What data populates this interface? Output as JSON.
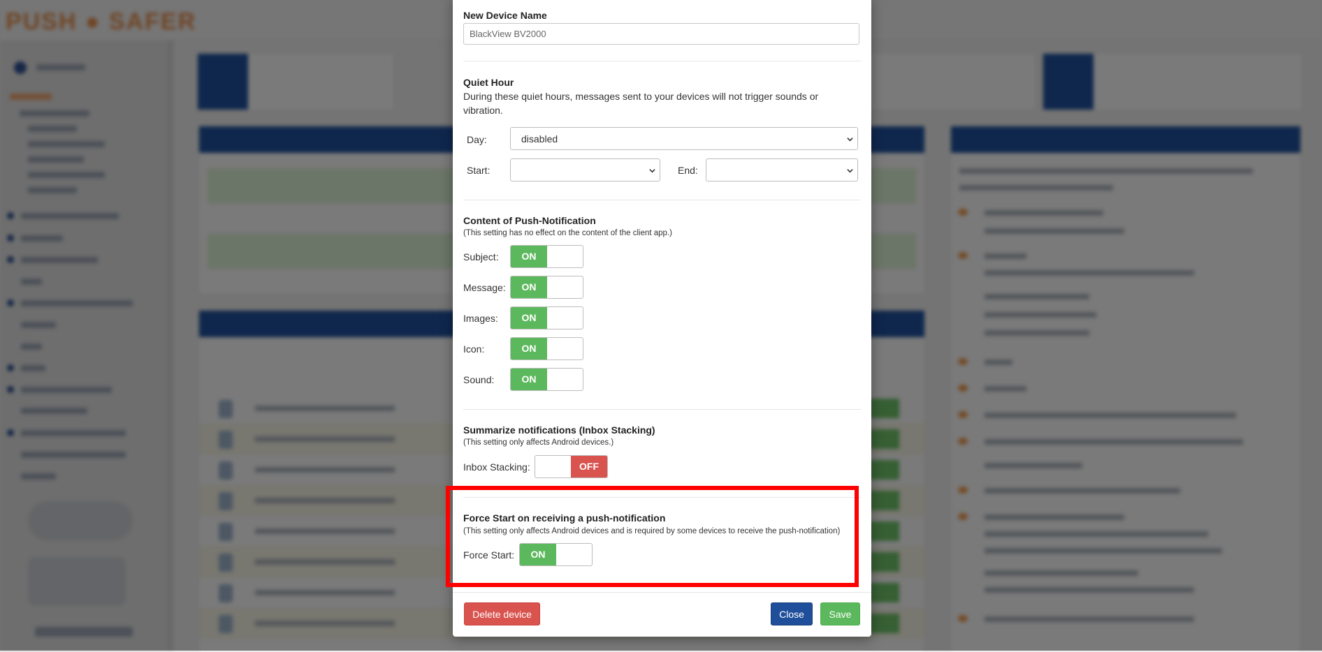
{
  "modal": {
    "device_name": {
      "heading": "New Device Name",
      "value": "BlackView BV2000"
    },
    "quiet_hour": {
      "heading": "Quiet Hour",
      "description": "During these quiet hours, messages sent to your devices will not trigger sounds or vibration.",
      "day_label": "Day:",
      "day_value": "disabled",
      "start_label": "Start:",
      "start_value": "",
      "end_label": "End:",
      "end_value": ""
    },
    "content": {
      "heading": "Content of Push-Notification",
      "note": "(This setting has no effect on the content of the client app.)",
      "rows": [
        {
          "label": "Subject:",
          "state": "ON"
        },
        {
          "label": "Message:",
          "state": "ON"
        },
        {
          "label": "Images:",
          "state": "ON"
        },
        {
          "label": "Icon:",
          "state": "ON"
        },
        {
          "label": "Sound:",
          "state": "ON"
        }
      ]
    },
    "inbox": {
      "heading": "Summarize notifications (Inbox Stacking)",
      "note": "(This setting only affects Android devices.)",
      "label": "Inbox Stacking:",
      "state": "OFF"
    },
    "force_start": {
      "heading": "Force Start on receiving a push-notification",
      "note": "(This setting only affects Android devices and is required by some devices to receive the push-notification)",
      "label": "Force Start:",
      "state": "ON"
    },
    "footer": {
      "delete_label": "Delete device",
      "close_label": "Close",
      "save_label": "Save"
    }
  },
  "colors": {
    "on": "#5cb85c",
    "off": "#d9534f",
    "primary": "#1f4f9a",
    "highlight": "#ff0000"
  }
}
